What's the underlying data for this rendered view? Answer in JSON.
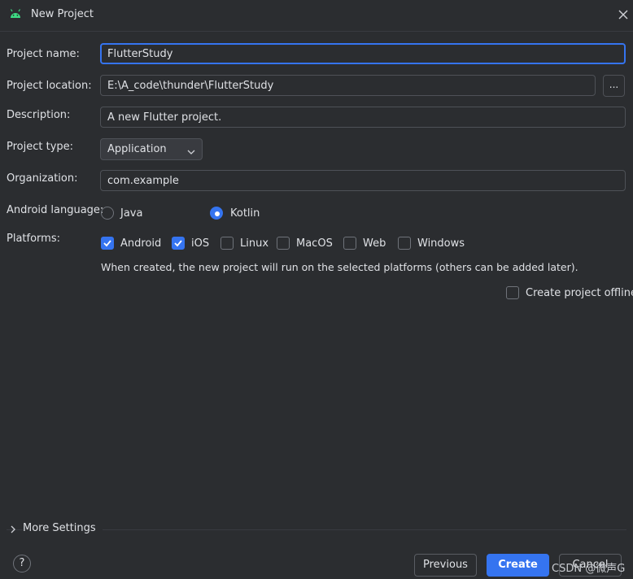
{
  "window": {
    "title": "New Project"
  },
  "form": {
    "project_name": {
      "label": "Project name:",
      "value": "FlutterStudy"
    },
    "project_location": {
      "label": "Project location:",
      "value": "E:\\A_code\\thunder\\FlutterStudy",
      "browse_label": "..."
    },
    "description": {
      "label": "Description:",
      "value": "A new Flutter project."
    },
    "project_type": {
      "label": "Project type:",
      "value": "Application"
    },
    "organization": {
      "label": "Organization:",
      "value": "com.example"
    },
    "android_language": {
      "label": "Android language:",
      "options": [
        {
          "label": "Java",
          "selected": false
        },
        {
          "label": "Kotlin",
          "selected": true
        }
      ]
    },
    "platforms": {
      "label": "Platforms:",
      "options": [
        {
          "label": "Android",
          "checked": true
        },
        {
          "label": "iOS",
          "checked": true
        },
        {
          "label": "Linux",
          "checked": false
        },
        {
          "label": "MacOS",
          "checked": false
        },
        {
          "label": "Web",
          "checked": false
        },
        {
          "label": "Windows",
          "checked": false
        }
      ],
      "note": "When created, the new project will run on the selected platforms (others can be added later)."
    },
    "offline": {
      "label": "Create project offline",
      "checked": false
    }
  },
  "more_settings": {
    "label": "More Settings"
  },
  "footer": {
    "help_label": "?",
    "previous_label": "Previous",
    "create_label": "Create",
    "cancel_label": "Cancel"
  },
  "watermark": "CSDN @微声G",
  "colors": {
    "accent": "#3574f0",
    "background": "#2b2d30",
    "android_green": "#3ddc84"
  }
}
